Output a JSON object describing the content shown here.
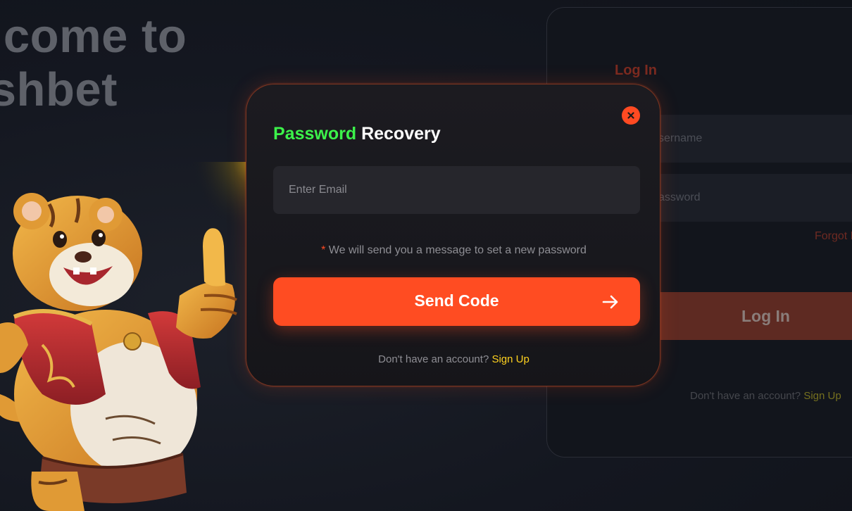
{
  "background": {
    "hero_line1": "elcome to",
    "hero_line2": "eshbet",
    "login_card": {
      "title": "Log In",
      "username_placeholder": "sername",
      "password_placeholder": "assword",
      "forgot_label": "Forgot F",
      "login_button": "Log In",
      "signup_prompt": "Don't have an account?",
      "signup_link": "Sign Up"
    }
  },
  "modal": {
    "title_accent": "Password",
    "title_rest": "Recovery",
    "email_placeholder": "Enter Email",
    "note_asterisk": "*",
    "note_text": "We will send you a message to set a new password",
    "send_button": "Send Code",
    "signup_prompt": "Don't have an account?",
    "signup_link": "Sign Up"
  },
  "colors": {
    "accent_orange": "#ff4c22",
    "title_green": "#3cf24a",
    "link_yellow": "#ffd21f"
  },
  "icons": {
    "close": "close-icon",
    "arrow": "arrow-right-icon"
  }
}
